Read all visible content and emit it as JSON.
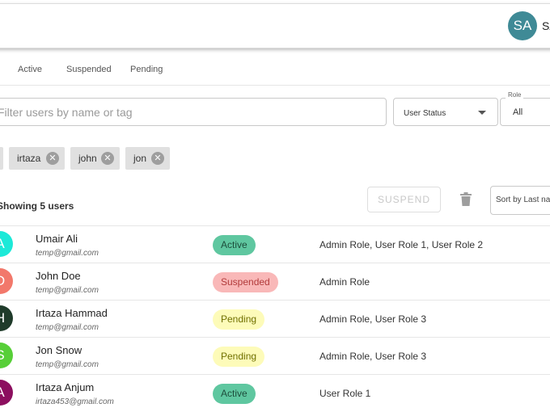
{
  "header": {
    "avatar_initials": "SA",
    "user_name": "SA"
  },
  "tabs": [
    "Active",
    "Suspended",
    "Pending"
  ],
  "search": {
    "placeholder": "Filter users by name or tag"
  },
  "filters": {
    "status_label": "User Status",
    "role_legend": "Role",
    "role_value": "All"
  },
  "chips": [
    "irtaza",
    "john",
    "jon"
  ],
  "toolbar": {
    "showing": "Showing 5 users",
    "suspend_label": "SUSPEND",
    "sort_label": "Sort by Last name"
  },
  "users": [
    {
      "initial": "A",
      "name": "Umair Ali",
      "email": "temp@gmail.com",
      "status": "Active",
      "roles": "Admin Role, User Role 1, User Role 2",
      "avatar_color": "#1de9d8"
    },
    {
      "initial": "D",
      "name": "John Doe",
      "email": "temp@gmail.com",
      "status": "Suspended",
      "roles": "Admin Role",
      "avatar_color": "#f2786b"
    },
    {
      "initial": "H",
      "name": "Irtaza Hammad",
      "email": "temp@gmail.com",
      "status": "Pending",
      "roles": "Admin Role, User Role 3",
      "avatar_color": "#1f3b2a"
    },
    {
      "initial": "S",
      "name": "Jon Snow",
      "email": "temp@gmail.com",
      "status": "Pending",
      "roles": "Admin Role, User Role 3",
      "avatar_color": "#57cf38"
    },
    {
      "initial": "A",
      "name": "Irtaza Anjum",
      "email": "irtaza453@gmail.com",
      "status": "Active",
      "roles": "User Role 1",
      "avatar_color": "#8c0f5f"
    }
  ]
}
